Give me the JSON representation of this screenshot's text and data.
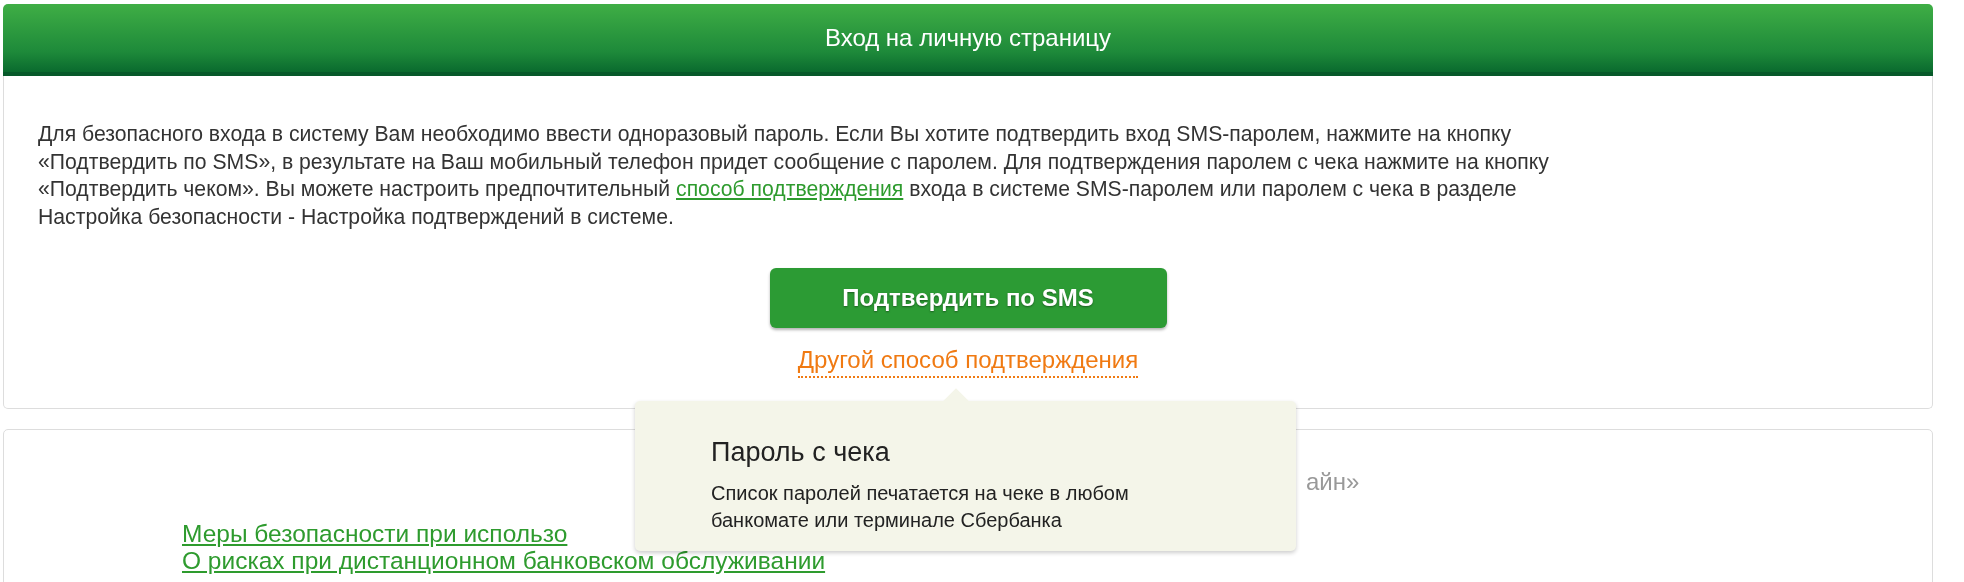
{
  "header": {
    "title": "Вход на личную страницу"
  },
  "intro": {
    "parts": [
      {
        "kind": "text",
        "text": "Для безопасного входа в систему Вам необходимо ввести одноразовый пароль. Если Вы хотите подтвердить вход SMS-паролем, нажмите на кнопку «Подтвердить по SMS», в результате на Ваш мобильный телефон придет сообщение с паролем. Для подтверждения паролем с чека нажмите на кнопку «Подтвердить чеком». Вы можете настроить предпочтительный "
      },
      {
        "kind": "link",
        "text": "способ подтверждения"
      },
      {
        "kind": "text",
        "text": " входа в системе SMS-паролем или паролем с чека в разделе Настройка безопасности - Настройка подтверждений в системе."
      }
    ]
  },
  "confirm_button": {
    "label": "Подтвердить по SMS"
  },
  "other_method_link": {
    "label": "Другой способ подтверждения"
  },
  "info_card": {
    "title_visible": "айн»",
    "links": [
      "Меры безопасности при использо",
      "О рисках при дистанционном банковском обслуживании"
    ]
  },
  "tooltip": {
    "title": "Пароль с чека",
    "text": "Список паролей печатается на чеке в любом банкомате или терминале Сбербанка"
  }
}
